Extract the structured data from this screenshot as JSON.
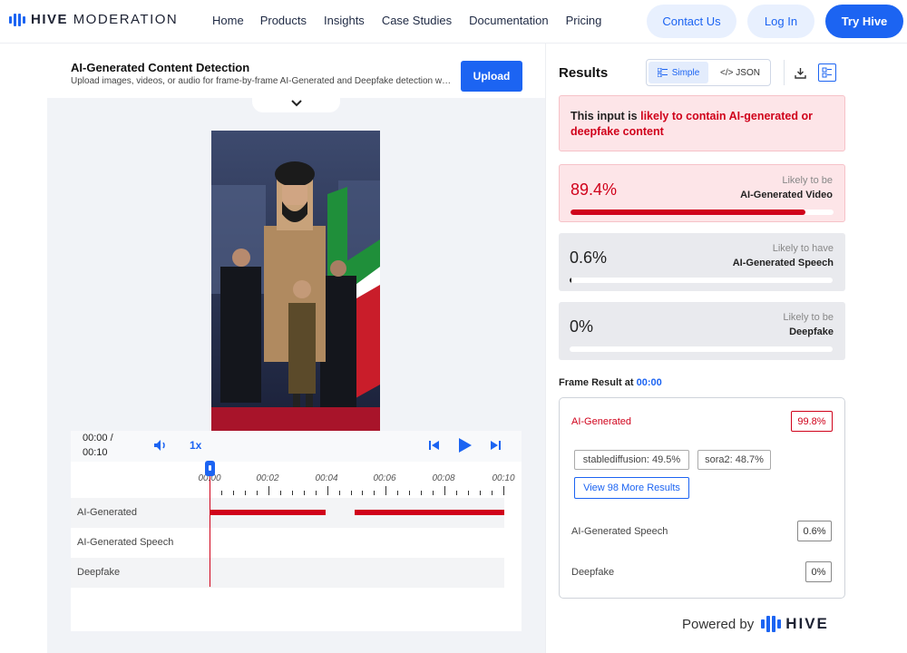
{
  "brand": {
    "logo_bold": "HIVE",
    "logo_light": "MODERATION"
  },
  "nav": {
    "links": [
      "Home",
      "Products",
      "Insights",
      "Case Studies",
      "Documentation",
      "Pricing"
    ],
    "contact_label": "Contact Us",
    "login_label": "Log In",
    "try_label": "Try Hive"
  },
  "tool": {
    "title": "AI-Generated Content Detection",
    "description": "Upload images, videos, or audio for frame-by-frame AI-Generated and Deepfake detection with...",
    "upload_label": "Upload"
  },
  "player": {
    "time_current": "00:00 /",
    "time_total": "00:10",
    "speed_label": "1x",
    "ticks": [
      "00:00",
      "00:02",
      "00:04",
      "00:06",
      "00:08",
      "00:10"
    ],
    "tracks": [
      {
        "label": "AI-Generated"
      },
      {
        "label": "AI-Generated Speech"
      },
      {
        "label": "Deepfake"
      }
    ]
  },
  "results": {
    "title": "Results",
    "view_simple": "Simple",
    "view_json": "</> JSON",
    "verdict_prefix": "This input is ",
    "verdict_highlight": "likely to contain AI-generated or deepfake content",
    "scores": [
      {
        "pct": "89.4%",
        "likely": "Likely to be",
        "name": "AI-Generated Video",
        "fraction": 0.894
      },
      {
        "pct": "0.6%",
        "likely": "Likely to have",
        "name": "AI-Generated Speech",
        "fraction": 0.006
      },
      {
        "pct": "0%",
        "likely": "Likely to be",
        "name": "Deepfake",
        "fraction": 0.0
      }
    ]
  },
  "frame": {
    "label": "Frame Result at ",
    "time": "00:00",
    "ai_label": "AI-Generated",
    "ai_score": "99.8%",
    "chips": [
      "stablediffusion: 49.5%",
      "sora2: 48.7%"
    ],
    "more_label": "View 98 More Results",
    "speech_label": "AI-Generated Speech",
    "speech_score": "0.6%",
    "deepfake_label": "Deepfake",
    "deepfake_score": "0%"
  },
  "footer": {
    "powered_label": "Powered by",
    "hive_label": "HIVE"
  },
  "colors": {
    "accent": "#1c64f2",
    "danger": "#d0021b"
  }
}
